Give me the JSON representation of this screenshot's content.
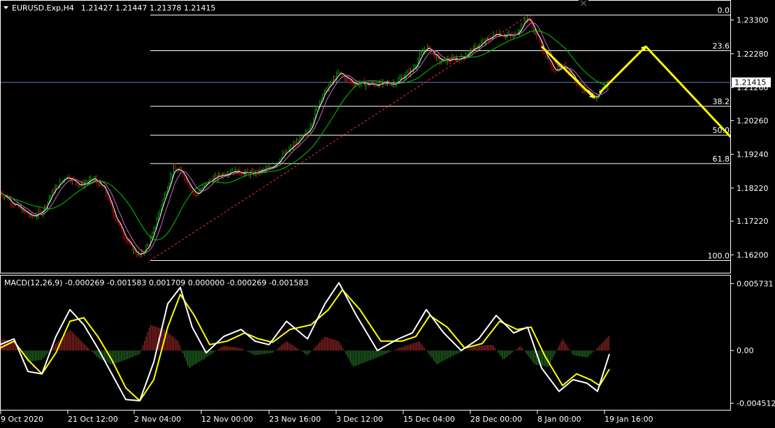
{
  "header": {
    "menu_arrow_icon": "triangle-down-icon",
    "symbol": "EURUSD.Exp,H4",
    "ohlc": "1.21427 1.21447 1.21378 1.21415",
    "close_icon": "close-icon"
  },
  "macd_header": {
    "label": "MACD(12,26,9) -0.000269 -0.001583 0.001709 0.000000 -0.000269 -0.001583"
  },
  "colors": {
    "background": "#000000",
    "axis": "#ffffff",
    "bull_candle": "#00b300",
    "bear_candle": "#e00000",
    "fib": "#ffffff",
    "arrow": "#ffff00",
    "ma_fast": "#ffffff",
    "ma_slow": "#00c800",
    "ma_mid": "#cc66cc",
    "macd_line": "#ffffff",
    "signal_line": "#ffff00",
    "hist_pos": "#c03030",
    "hist_neg": "#2e8b2e",
    "current_price_line": "#6a7fbf",
    "trend_line": "#ff3030"
  },
  "chart_data": [
    {
      "type": "candlestick",
      "title": "EURUSD.Exp,H4",
      "current_price": "1.21415",
      "y_ticks": [
        "1.23300",
        "1.22280",
        "1.21260",
        "1.20260",
        "1.19240",
        "1.18220",
        "1.17220",
        "1.16200"
      ],
      "ylim": [
        1.1585,
        1.2365
      ],
      "x_ticks": [
        "9 Oct 2020",
        "21 Oct 12:00",
        "2 Nov 04:00",
        "12 Nov 00:00",
        "23 Nov 16:00",
        "3 Dec 12:00",
        "15 Dec 04:00",
        "28 Dec 00:00",
        "8 Jan 00:00",
        "19 Jan 16:00"
      ],
      "fibonacci": {
        "levels": [
          {
            "label": "0.0",
            "value": 1.2345
          },
          {
            "label": "23.6",
            "value": 1.2237
          },
          {
            "label": "38.2",
            "value": 1.2069
          },
          {
            "label": "50.0",
            "value": 1.1982
          },
          {
            "label": "61.8",
            "value": 1.1896
          },
          {
            "label": "100.0",
            "value": 1.1603
          }
        ]
      },
      "price_path": [
        {
          "t": 0,
          "p": 1.181
        },
        {
          "t": 25,
          "p": 1.1765
        },
        {
          "t": 45,
          "p": 1.1735
        },
        {
          "t": 60,
          "p": 1.175
        },
        {
          "t": 75,
          "p": 1.181
        },
        {
          "t": 95,
          "p": 1.186
        },
        {
          "t": 115,
          "p": 1.183
        },
        {
          "t": 135,
          "p": 1.185
        },
        {
          "t": 150,
          "p": 1.1815
        },
        {
          "t": 165,
          "p": 1.173
        },
        {
          "t": 185,
          "p": 1.165
        },
        {
          "t": 200,
          "p": 1.1615
        },
        {
          "t": 215,
          "p": 1.166
        },
        {
          "t": 232,
          "p": 1.178
        },
        {
          "t": 248,
          "p": 1.188
        },
        {
          "t": 260,
          "p": 1.187
        },
        {
          "t": 280,
          "p": 1.18
        },
        {
          "t": 300,
          "p": 1.1845
        },
        {
          "t": 330,
          "p": 1.1875
        },
        {
          "t": 360,
          "p": 1.1865
        },
        {
          "t": 385,
          "p": 1.188
        },
        {
          "t": 410,
          "p": 1.193
        },
        {
          "t": 440,
          "p": 1.199
        },
        {
          "t": 460,
          "p": 1.21
        },
        {
          "t": 485,
          "p": 1.217
        },
        {
          "t": 505,
          "p": 1.214
        },
        {
          "t": 535,
          "p": 1.2135
        },
        {
          "t": 565,
          "p": 1.214
        },
        {
          "t": 590,
          "p": 1.218
        },
        {
          "t": 610,
          "p": 1.225
        },
        {
          "t": 630,
          "p": 1.2205
        },
        {
          "t": 660,
          "p": 1.2215
        },
        {
          "t": 690,
          "p": 1.226
        },
        {
          "t": 710,
          "p": 1.229
        },
        {
          "t": 735,
          "p": 1.228
        },
        {
          "t": 755,
          "p": 1.234
        },
        {
          "t": 775,
          "p": 1.225
        },
        {
          "t": 790,
          "p": 1.218
        },
        {
          "t": 810,
          "p": 1.219
        },
        {
          "t": 830,
          "p": 1.213
        },
        {
          "t": 850,
          "p": 1.209
        },
        {
          "t": 862,
          "p": 1.2125
        },
        {
          "t": 872,
          "p": 1.2141
        }
      ],
      "projection_arrows": [
        {
          "from": [
            775,
            1.225
          ],
          "to": [
            850,
            1.2095
          ]
        },
        {
          "from": [
            858,
            1.211
          ],
          "to": [
            924,
            1.225
          ]
        },
        {
          "from": [
            924,
            1.225
          ],
          "to": [
            1055,
            1.1955
          ]
        }
      ],
      "trend_line": {
        "from": [
          215,
          1.1603
        ],
        "to": [
          757,
          1.2345
        ]
      }
    },
    {
      "type": "macd",
      "title": "MACD(12,26,9)",
      "y_ticks": [
        "0.005731",
        "0.00",
        "-0.004512"
      ],
      "ylim": [
        -0.0046,
        0.006
      ],
      "macd": [
        {
          "t": 0,
          "v": 0.0005
        },
        {
          "t": 20,
          "v": 0.001
        },
        {
          "t": 40,
          "v": -0.0018
        },
        {
          "t": 60,
          "v": -0.002
        },
        {
          "t": 80,
          "v": 0.0012
        },
        {
          "t": 100,
          "v": 0.0035
        },
        {
          "t": 120,
          "v": 0.0022
        },
        {
          "t": 140,
          "v": 0.0002
        },
        {
          "t": 160,
          "v": -0.002
        },
        {
          "t": 180,
          "v": -0.0042
        },
        {
          "t": 200,
          "v": -0.0043
        },
        {
          "t": 220,
          "v": -0.001
        },
        {
          "t": 240,
          "v": 0.004
        },
        {
          "t": 258,
          "v": 0.0054
        },
        {
          "t": 275,
          "v": 0.002
        },
        {
          "t": 295,
          "v": -0.0002
        },
        {
          "t": 320,
          "v": 0.0012
        },
        {
          "t": 345,
          "v": 0.0018
        },
        {
          "t": 365,
          "v": 0.0008
        },
        {
          "t": 385,
          "v": 0.0005
        },
        {
          "t": 410,
          "v": 0.0025
        },
        {
          "t": 440,
          "v": 0.001
        },
        {
          "t": 465,
          "v": 0.004
        },
        {
          "t": 485,
          "v": 0.0058
        },
        {
          "t": 510,
          "v": 0.003
        },
        {
          "t": 540,
          "v": 0.0
        },
        {
          "t": 570,
          "v": 0.001
        },
        {
          "t": 590,
          "v": 0.0015
        },
        {
          "t": 610,
          "v": 0.0035
        },
        {
          "t": 635,
          "v": 0.0015
        },
        {
          "t": 660,
          "v": 0.0
        },
        {
          "t": 685,
          "v": 0.001
        },
        {
          "t": 710,
          "v": 0.003
        },
        {
          "t": 735,
          "v": 0.0015
        },
        {
          "t": 755,
          "v": 0.002
        },
        {
          "t": 775,
          "v": -0.0015
        },
        {
          "t": 800,
          "v": -0.0035
        },
        {
          "t": 820,
          "v": -0.0025
        },
        {
          "t": 840,
          "v": -0.0028
        },
        {
          "t": 855,
          "v": -0.0035
        },
        {
          "t": 872,
          "v": -0.0003
        }
      ],
      "signal": [
        {
          "t": 0,
          "v": 0.0002
        },
        {
          "t": 20,
          "v": 0.0008
        },
        {
          "t": 40,
          "v": -0.0008
        },
        {
          "t": 60,
          "v": -0.002
        },
        {
          "t": 80,
          "v": -0.0002
        },
        {
          "t": 100,
          "v": 0.0025
        },
        {
          "t": 120,
          "v": 0.0028
        },
        {
          "t": 140,
          "v": 0.0012
        },
        {
          "t": 160,
          "v": -0.0008
        },
        {
          "t": 180,
          "v": -0.0032
        },
        {
          "t": 200,
          "v": -0.0043
        },
        {
          "t": 220,
          "v": -0.0025
        },
        {
          "t": 240,
          "v": 0.002
        },
        {
          "t": 258,
          "v": 0.0048
        },
        {
          "t": 278,
          "v": 0.003
        },
        {
          "t": 300,
          "v": 0.0005
        },
        {
          "t": 325,
          "v": 0.0008
        },
        {
          "t": 350,
          "v": 0.0015
        },
        {
          "t": 370,
          "v": 0.001
        },
        {
          "t": 390,
          "v": 0.0007
        },
        {
          "t": 415,
          "v": 0.0018
        },
        {
          "t": 445,
          "v": 0.0022
        },
        {
          "t": 470,
          "v": 0.0035
        },
        {
          "t": 490,
          "v": 0.0052
        },
        {
          "t": 515,
          "v": 0.0035
        },
        {
          "t": 545,
          "v": 0.0008
        },
        {
          "t": 575,
          "v": 0.0008
        },
        {
          "t": 595,
          "v": 0.0012
        },
        {
          "t": 615,
          "v": 0.003
        },
        {
          "t": 640,
          "v": 0.002
        },
        {
          "t": 665,
          "v": 0.0002
        },
        {
          "t": 690,
          "v": 0.0006
        },
        {
          "t": 715,
          "v": 0.0025
        },
        {
          "t": 740,
          "v": 0.0018
        },
        {
          "t": 760,
          "v": 0.002
        },
        {
          "t": 780,
          "v": -0.0005
        },
        {
          "t": 805,
          "v": -0.003
        },
        {
          "t": 825,
          "v": -0.002
        },
        {
          "t": 845,
          "v": -0.0025
        },
        {
          "t": 858,
          "v": -0.003
        },
        {
          "t": 872,
          "v": -0.0016
        }
      ],
      "histogram": [
        {
          "t": 0,
          "v": 0.001
        },
        {
          "t": 20,
          "v": 0.0008
        },
        {
          "t": 40,
          "v": -0.001
        },
        {
          "t": 60,
          "v": -0.0008
        },
        {
          "t": 80,
          "v": 0.0006
        },
        {
          "t": 100,
          "v": 0.0018
        },
        {
          "t": 120,
          "v": 0.0006
        },
        {
          "t": 140,
          "v": -0.0006
        },
        {
          "t": 160,
          "v": -0.0012
        },
        {
          "t": 180,
          "v": -0.0008
        },
        {
          "t": 200,
          "v": -0.0003
        },
        {
          "t": 215,
          "v": 0.0022
        },
        {
          "t": 235,
          "v": 0.0018
        },
        {
          "t": 255,
          "v": 0.0008
        },
        {
          "t": 270,
          "v": -0.0015
        },
        {
          "t": 290,
          "v": -0.0008
        },
        {
          "t": 320,
          "v": 0.0004
        },
        {
          "t": 345,
          "v": 0.0002
        },
        {
          "t": 365,
          "v": -0.0004
        },
        {
          "t": 390,
          "v": -0.0002
        },
        {
          "t": 410,
          "v": 0.0008
        },
        {
          "t": 440,
          "v": -0.0004
        },
        {
          "t": 465,
          "v": 0.0012
        },
        {
          "t": 485,
          "v": 0.0008
        },
        {
          "t": 505,
          "v": -0.0014
        },
        {
          "t": 540,
          "v": -0.0006
        },
        {
          "t": 570,
          "v": 0.0002
        },
        {
          "t": 600,
          "v": 0.0008
        },
        {
          "t": 625,
          "v": -0.0012
        },
        {
          "t": 650,
          "v": -0.0004
        },
        {
          "t": 680,
          "v": 0.0004
        },
        {
          "t": 705,
          "v": 0.0005
        },
        {
          "t": 720,
          "v": -0.0008
        },
        {
          "t": 745,
          "v": 0.0004
        },
        {
          "t": 765,
          "v": -0.0012
        },
        {
          "t": 785,
          "v": -0.0014
        },
        {
          "t": 805,
          "v": 0.001
        },
        {
          "t": 820,
          "v": -0.0004
        },
        {
          "t": 840,
          "v": -0.0006
        },
        {
          "t": 858,
          "v": 0.0004
        },
        {
          "t": 872,
          "v": 0.0013
        }
      ]
    }
  ]
}
